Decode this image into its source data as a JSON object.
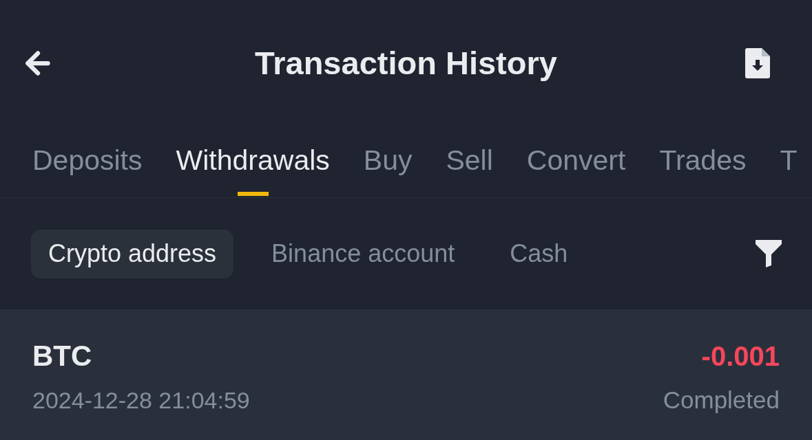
{
  "header": {
    "title": "Transaction History"
  },
  "tabs": [
    {
      "label": "Deposits",
      "selected": false
    },
    {
      "label": "Withdrawals",
      "selected": true
    },
    {
      "label": "Buy",
      "selected": false
    },
    {
      "label": "Sell",
      "selected": false
    },
    {
      "label": "Convert",
      "selected": false
    },
    {
      "label": "Trades",
      "selected": false
    },
    {
      "label": "T",
      "selected": false
    }
  ],
  "filters": [
    {
      "label": "Crypto address",
      "selected": true
    },
    {
      "label": "Binance account",
      "selected": false
    },
    {
      "label": "Cash",
      "selected": false
    }
  ],
  "transactions": [
    {
      "coin": "BTC",
      "datetime": "2024-12-28 21:04:59",
      "amount": "-0.001",
      "status": "Completed"
    }
  ]
}
